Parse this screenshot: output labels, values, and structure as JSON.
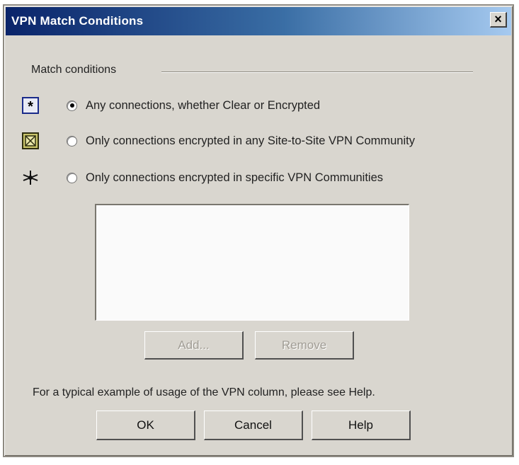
{
  "window": {
    "title": "VPN Match Conditions",
    "close_label": "×"
  },
  "group": {
    "label": "Match conditions"
  },
  "options": [
    {
      "label": "Any connections, whether Clear or Encrypted",
      "selected": true,
      "icon": "asterisk-box-icon"
    },
    {
      "label": "Only connections encrypted in any Site-to-Site VPN Community",
      "selected": false,
      "icon": "community-box-icon"
    },
    {
      "label": "Only connections encrypted in specific VPN Communities",
      "selected": false,
      "icon": "star-network-icon"
    }
  ],
  "list": {
    "items": []
  },
  "list_buttons": {
    "add": "Add...",
    "remove": "Remove"
  },
  "help_text": "For a typical example of usage of the VPN column, please see Help.",
  "footer_buttons": {
    "ok": "OK",
    "cancel": "Cancel",
    "help": "Help"
  },
  "colors": {
    "titlebar_start": "#0a246a",
    "titlebar_end": "#a6caf0",
    "dialog_bg": "#d9d6cf"
  }
}
